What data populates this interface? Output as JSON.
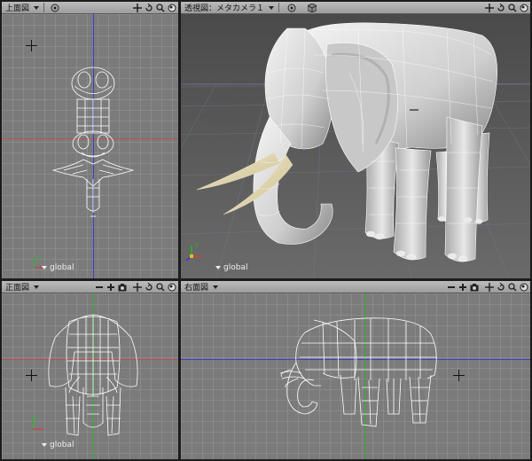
{
  "viewports": {
    "top": {
      "title": "上面図",
      "coord_label": "global"
    },
    "persp": {
      "title": "透視図：メタカメラ１",
      "coord_label": "global"
    },
    "front": {
      "title": "正面図",
      "coord_label": "global"
    },
    "right": {
      "title": "右面図",
      "coord_label": "global"
    }
  },
  "icons": [
    "menu-arrow-icon",
    "target-icon",
    "zoom-out-icon",
    "zoom-in-icon",
    "camera-icon",
    "pan-icon",
    "rotate-icon",
    "magnify-icon",
    "fit-icon",
    "cube-icon"
  ],
  "colors": {
    "axis_x": "#d04040",
    "axis_y": "#3a3ad0",
    "axis_z": "#30b030",
    "wire": "#ffffff",
    "viewport_bg": "#7a7a7a",
    "persp_bg": "#575757",
    "toolbar": "#acacac"
  }
}
